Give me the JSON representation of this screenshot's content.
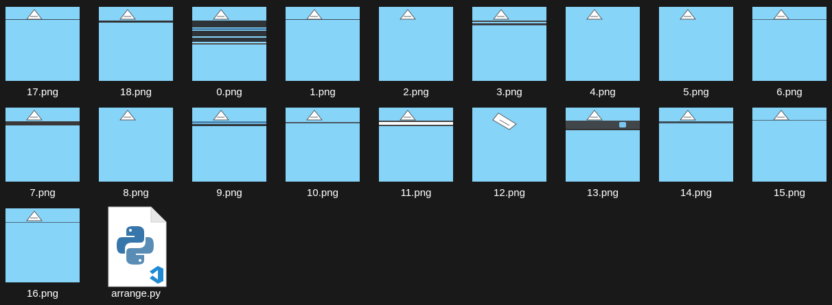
{
  "folder_view": {
    "background": "#191919",
    "thumbnail_color": "#87d4f9",
    "items": [
      {
        "name": "17.png",
        "type": "image"
      },
      {
        "name": "18.png",
        "type": "image"
      },
      {
        "name": "0.png",
        "type": "image"
      },
      {
        "name": "1.png",
        "type": "image"
      },
      {
        "name": "2.png",
        "type": "image"
      },
      {
        "name": "3.png",
        "type": "image"
      },
      {
        "name": "4.png",
        "type": "image"
      },
      {
        "name": "5.png",
        "type": "image"
      },
      {
        "name": "6.png",
        "type": "image"
      },
      {
        "name": "7.png",
        "type": "image"
      },
      {
        "name": "8.png",
        "type": "image"
      },
      {
        "name": "9.png",
        "type": "image"
      },
      {
        "name": "10.png",
        "type": "image"
      },
      {
        "name": "11.png",
        "type": "image"
      },
      {
        "name": "12.png",
        "type": "image"
      },
      {
        "name": "13.png",
        "type": "image"
      },
      {
        "name": "14.png",
        "type": "image"
      },
      {
        "name": "15.png",
        "type": "image"
      },
      {
        "name": "16.png",
        "type": "image"
      },
      {
        "name": "arrange.py",
        "type": "python-file",
        "icon": "python-file-vscode-icon"
      }
    ]
  }
}
